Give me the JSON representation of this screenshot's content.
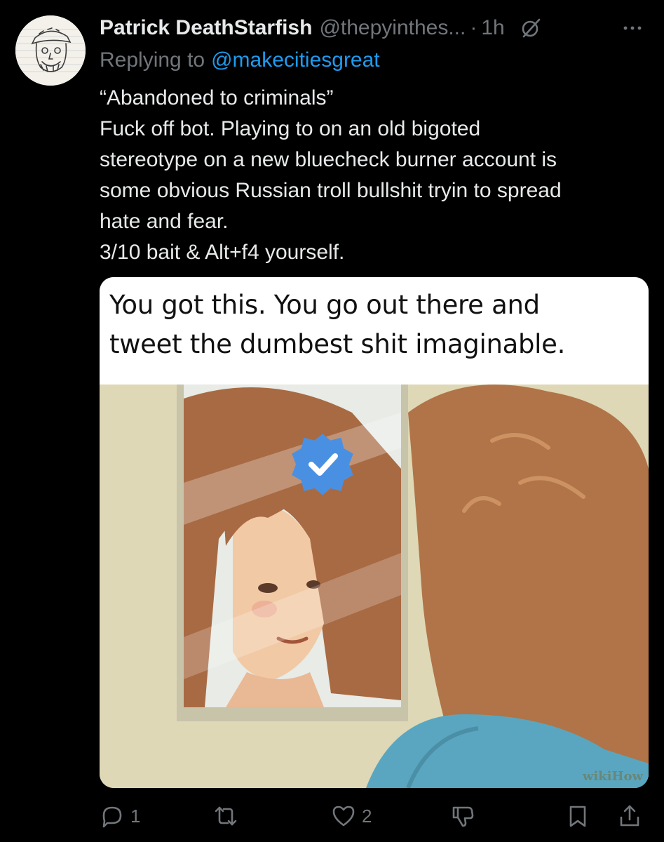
{
  "author": {
    "display_name": "Patrick DeathStarfish",
    "handle": "@thepyinthes...",
    "time": "1h"
  },
  "reply": {
    "prefix": "Replying to",
    "mention": "@makecitiesgreat"
  },
  "tweet": {
    "lines": [
      "“Abandoned to criminals”",
      "Fuck off bot. Playing to on an old bigoted",
      "stereotype on a new bluecheck burner account is",
      "some obvious Russian troll bullshit tryin to spread",
      "hate and fear.",
      "3/10 bait & Alt+f4 yourself."
    ]
  },
  "media": {
    "caption_lines": [
      "You got this. You go out there and",
      "tweet the dumbest shit imaginable."
    ],
    "watermark": "wikiHow"
  },
  "actions": {
    "reply_count": "1",
    "retweet_count": "",
    "like_count": "2"
  },
  "icons": [
    "grok-icon",
    "more-icon",
    "reply-icon",
    "retweet-icon",
    "like-icon",
    "downvote-icon",
    "bookmark-icon",
    "share-icon"
  ],
  "colors": {
    "background": "#000000",
    "text": "#e7e9ea",
    "muted": "#71767b",
    "link": "#1d9bf0",
    "verified_badge": "#4a90e2"
  }
}
